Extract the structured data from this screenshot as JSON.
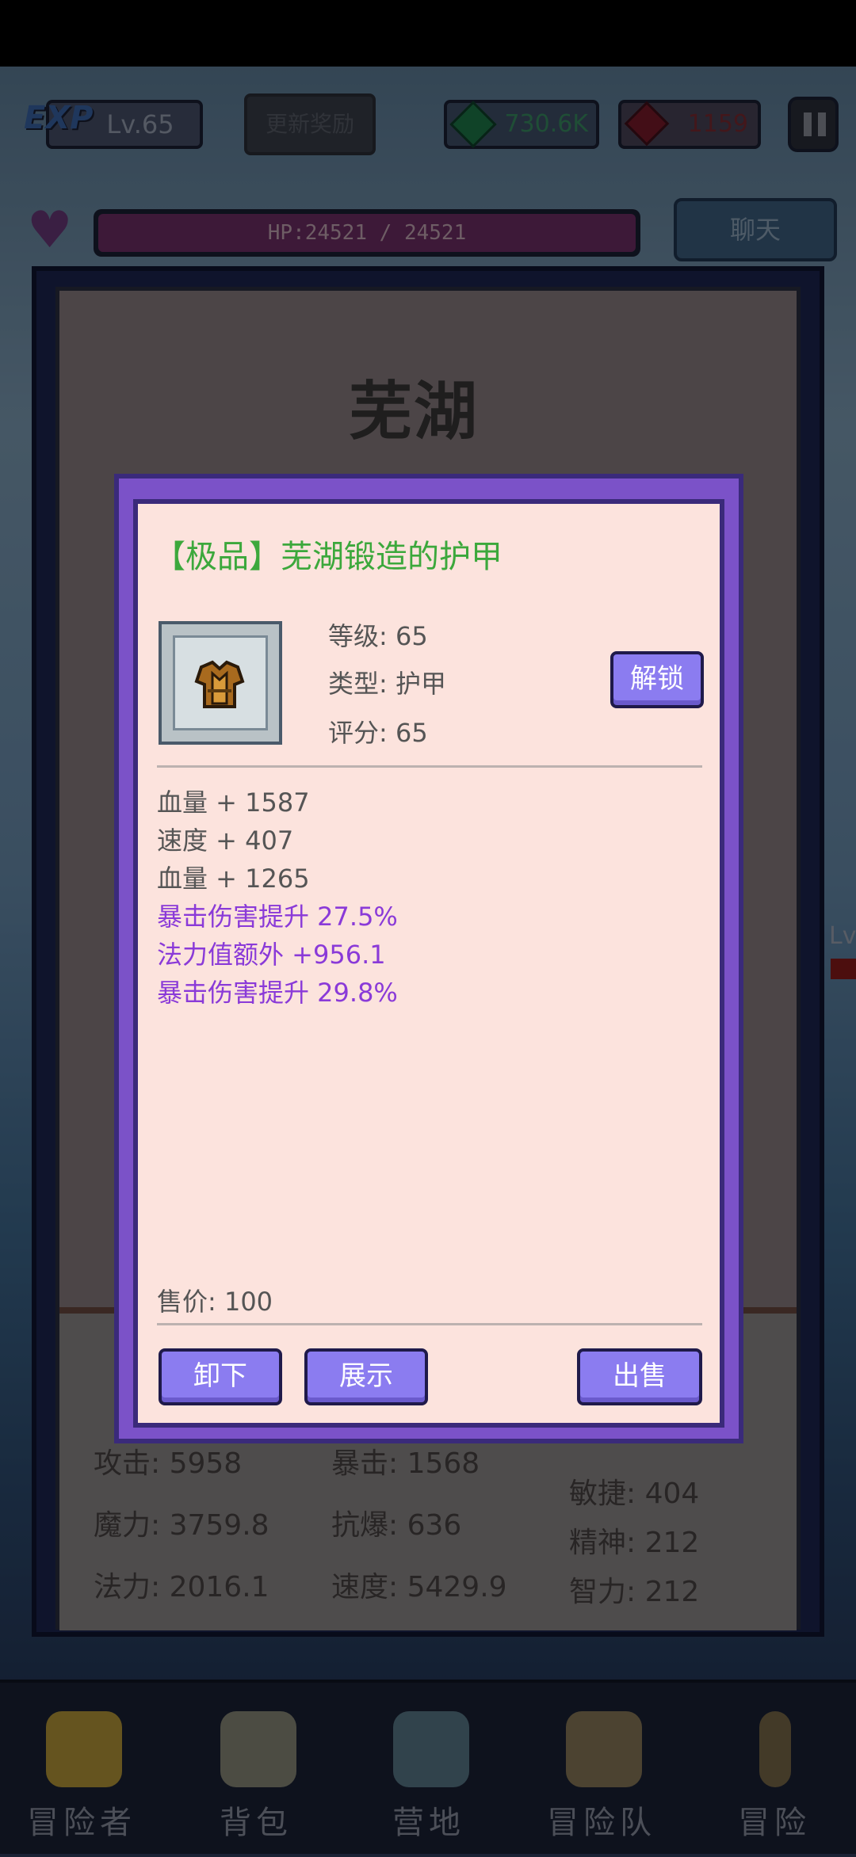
{
  "hud": {
    "exp_label": "EXP",
    "level": "Lv.65",
    "reward_button": "更新奖励",
    "gems": "730.6K",
    "rubies": "1159",
    "hp": "HP:24521 / 24521",
    "chat_button": "聊天"
  },
  "panel": {
    "title": "芜湖",
    "stats_left": [
      "攻击: 5958",
      "魔力: 3759.8",
      "法力: 2016.1"
    ],
    "stats_mid": [
      "暴击: 1568",
      "抗爆: 636",
      "速度: 5429.9"
    ],
    "stats_right": [
      "敏捷: 404",
      "精神: 212",
      "智力: 212"
    ],
    "side_level": "Lv"
  },
  "item": {
    "title": "【极品】芜湖锻造的护甲",
    "icon": "armor-icon",
    "level_line": "等级: 65",
    "type_line": "类型: 护甲",
    "score_line": "评分: 65",
    "unlock_button": "解锁",
    "attributes": [
      {
        "text": "血量 + 1587",
        "color": "gray"
      },
      {
        "text": "速度 + 407",
        "color": "gray"
      },
      {
        "text": "血量 + 1265",
        "color": "gray"
      },
      {
        "text": "暴击伤害提升 27.5%",
        "color": "purple"
      },
      {
        "text": "法力值额外 +956.1",
        "color": "purple"
      },
      {
        "text": "暴击伤害提升 29.8%",
        "color": "purple"
      }
    ],
    "price_line": "售价: 100",
    "unequip_button": "卸下",
    "show_button": "展示",
    "sell_button": "出售"
  },
  "nav": {
    "items": [
      {
        "label": "冒险者",
        "icon": "helmet-icon"
      },
      {
        "label": "背包",
        "icon": "backpack-icon"
      },
      {
        "label": "营地",
        "icon": "camp-icon"
      },
      {
        "label": "冒险队",
        "icon": "book-icon"
      },
      {
        "label": "冒险",
        "icon": "sword-icon"
      }
    ]
  },
  "colors": {
    "dialog_border": "#7b52c8",
    "dialog_bg": "#fce3dd",
    "title_green": "#3ca83c",
    "attr_purple": "#8a3ad8",
    "button_purple": "#8b7cf0"
  }
}
